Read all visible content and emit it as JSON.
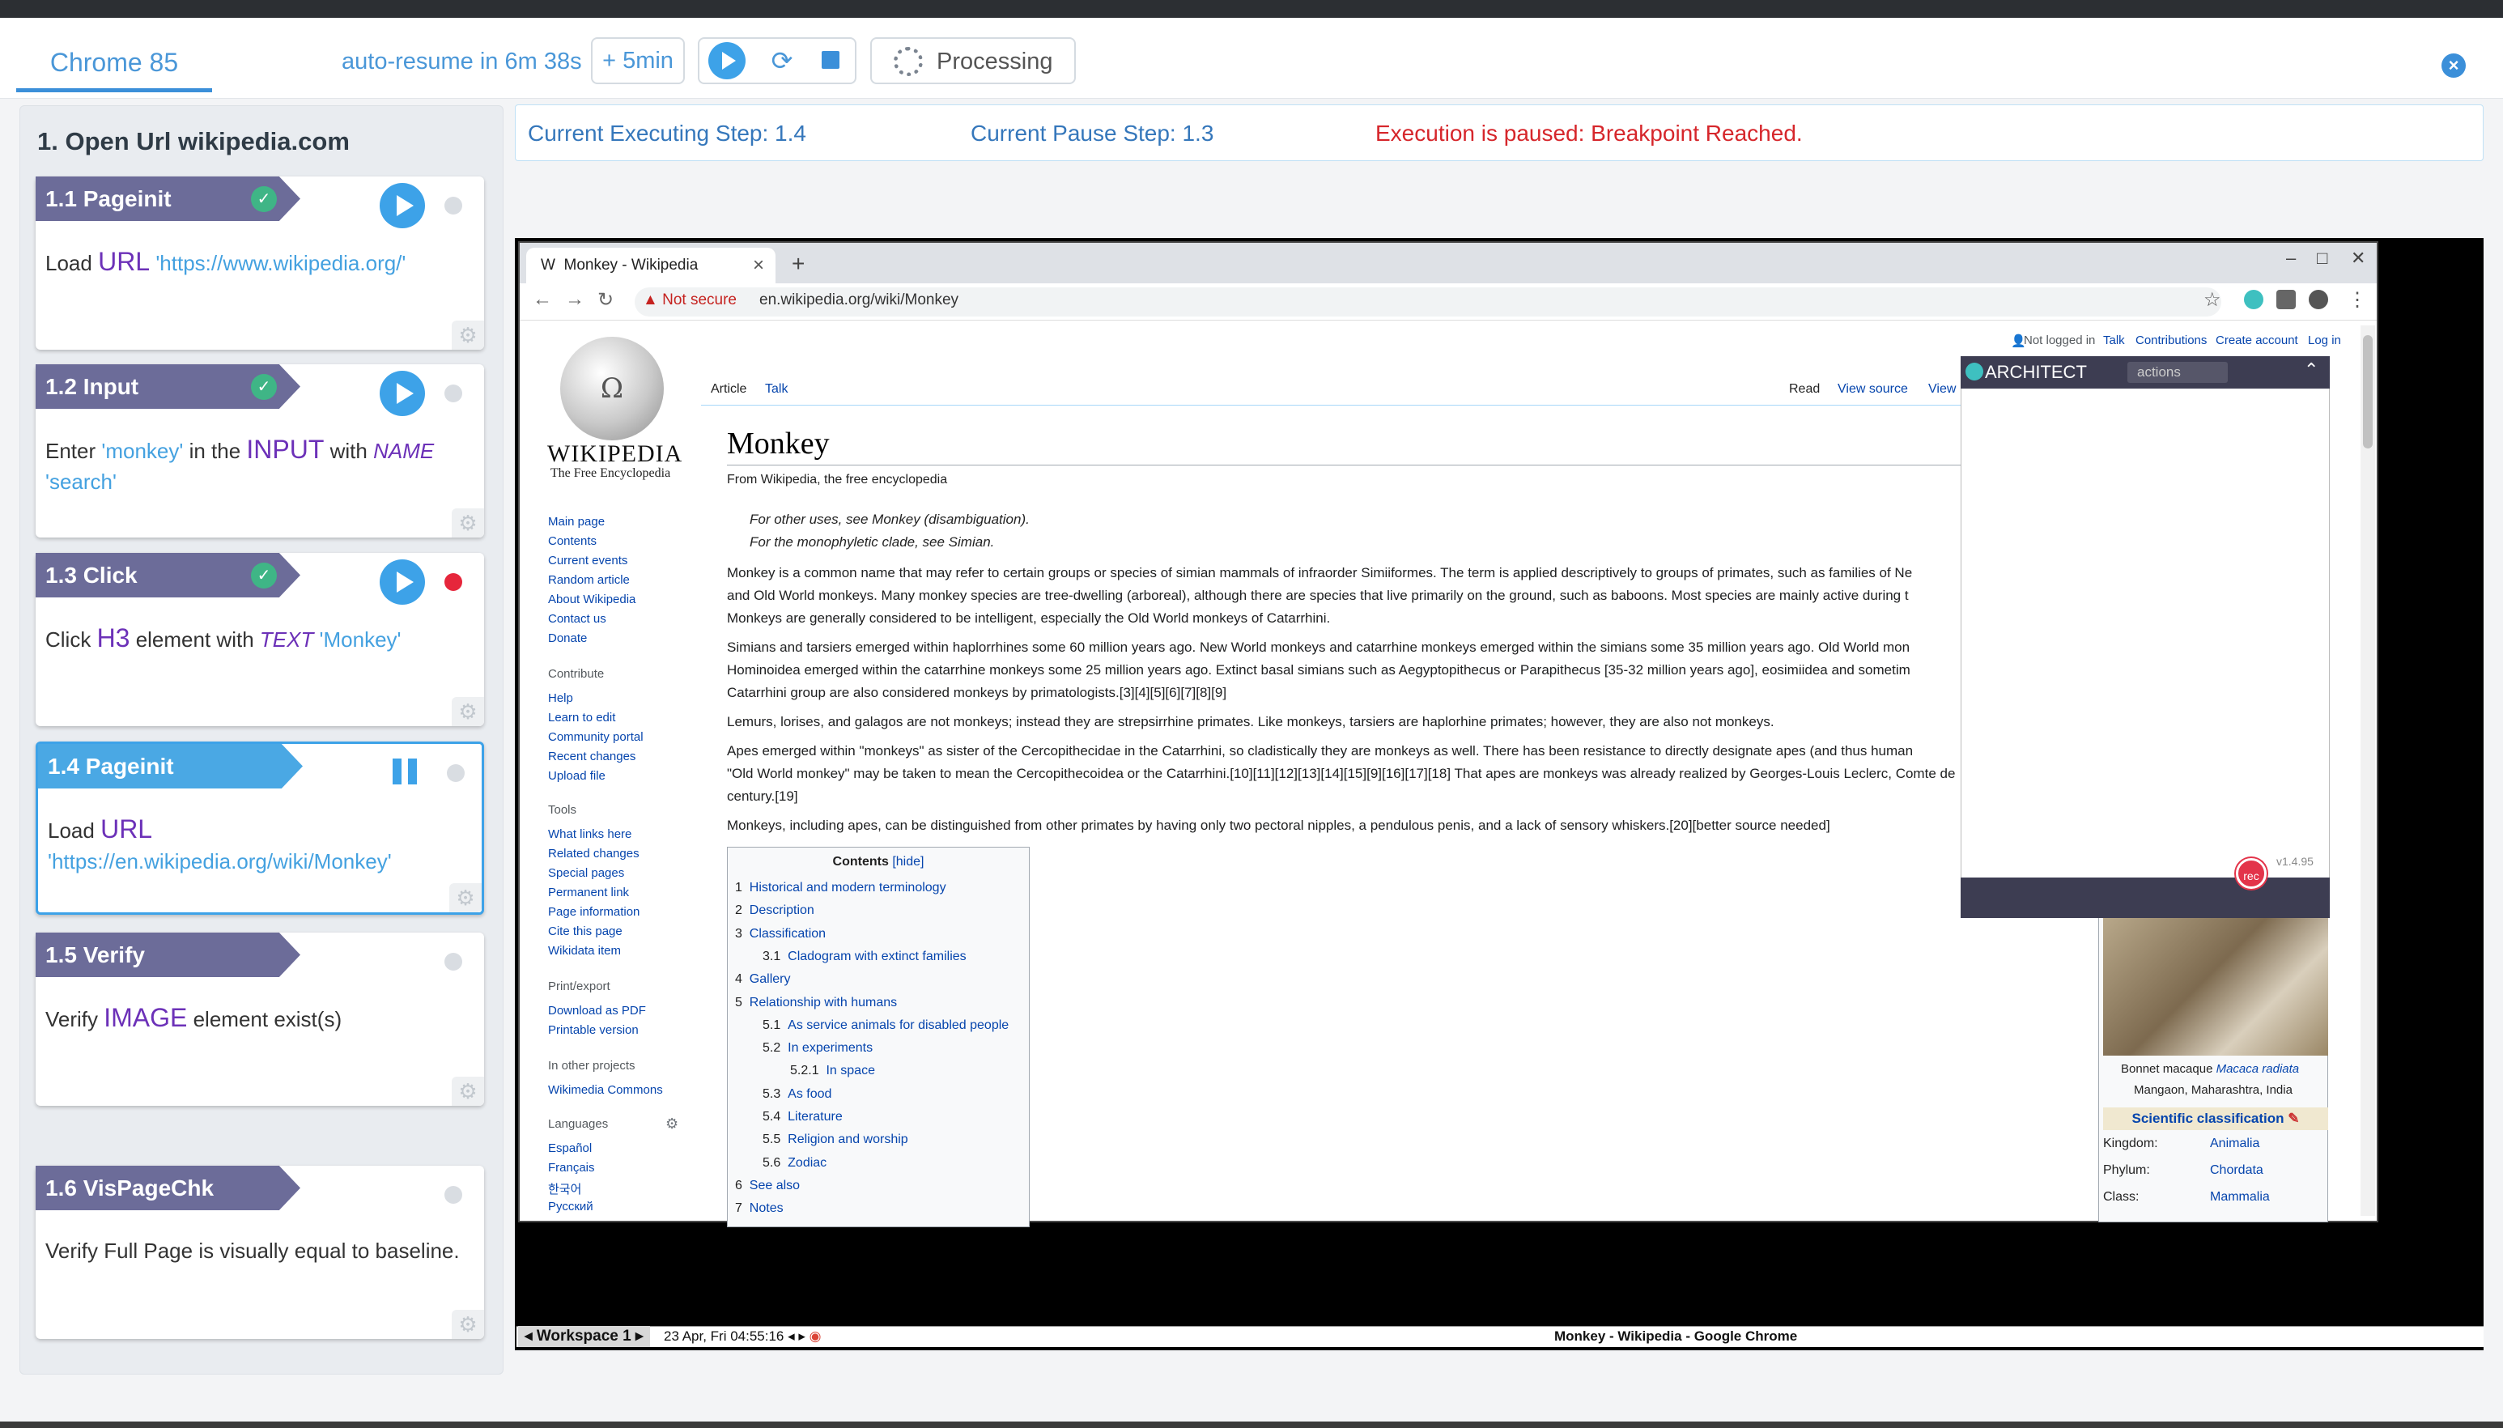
{
  "header": {
    "tab_title": "Chrome 85",
    "auto_resume": "auto-resume in 6m 38s",
    "add_time": "5min",
    "processing": "Processing"
  },
  "steps": {
    "heading": "1. Open Url wikipedia.com",
    "cards": [
      {
        "title": "1.1 Pageinit",
        "status": "passed",
        "parts": [
          "Load ",
          "URL",
          " 'https://www.wikipedia.org/'"
        ]
      },
      {
        "title": "1.2 Input",
        "status": "passed",
        "parts": [
          "Enter ",
          "'monkey'",
          " in the ",
          "INPUT",
          " with ",
          "NAME",
          " 'search'"
        ]
      },
      {
        "title": "1.3 Click",
        "status": "passed",
        "parts": [
          "Click ",
          "H3",
          " element with ",
          "TEXT",
          " 'Monkey'"
        ]
      },
      {
        "title": "1.4 Pageinit",
        "status": "paused",
        "parts": [
          "Load ",
          "URL",
          " 'https://en.wikipedia.org/wiki/Monkey'"
        ]
      },
      {
        "title": "1.5 Verify",
        "status": "pending",
        "parts": [
          "Verify ",
          "IMAGE",
          " element exist(s)"
        ]
      },
      {
        "title": "1.6 VisPageChk",
        "status": "pending",
        "parts": [
          "Verify Full Page is visually equal to baseline."
        ]
      }
    ]
  },
  "status": {
    "executing": "Current Executing Step: 1.4",
    "pause": "Current Pause Step: 1.3",
    "message": "Execution is paused: Breakpoint Reached.",
    "message_color": "#d6262b"
  },
  "browser": {
    "tab_title": "Monkey - Wikipedia",
    "not_secure": "Not secure",
    "url": "en.wikipedia.org/wiki/Monkey",
    "window_title": "Monkey - Wikipedia - Google Chrome",
    "workspace": "Workspace 1",
    "datetime": "23 Apr, Fri 04:55:16"
  },
  "wikipedia": {
    "logo_name": "WIKIPEDIA",
    "logo_tagline": "The Free Encyclopedia",
    "tabs": {
      "article": "Article",
      "talk": "Talk",
      "read": "Read",
      "view_source": "View source",
      "view": "View"
    },
    "user_links": [
      "Not logged in",
      "Talk",
      "Contributions",
      "Create account",
      "Log in"
    ],
    "sidebar": {
      "main": [
        "Main page",
        "Contents",
        "Current events",
        "Random article",
        "About Wikipedia",
        "Contact us",
        "Donate"
      ],
      "contribute_heading": "Contribute",
      "contribute": [
        "Help",
        "Learn to edit",
        "Community portal",
        "Recent changes",
        "Upload file"
      ],
      "tools_heading": "Tools",
      "tools": [
        "What links here",
        "Related changes",
        "Special pages",
        "Permanent link",
        "Page information",
        "Cite this page",
        "Wikidata item"
      ],
      "print_heading": "Print/export",
      "print": [
        "Download as PDF",
        "Printable version"
      ],
      "other_heading": "In other projects",
      "other": [
        "Wikimedia Commons"
      ],
      "lang_heading": "Languages",
      "languages": [
        "Español",
        "Français",
        "한국어",
        "Русский"
      ]
    },
    "title": "Monkey",
    "from": "From Wikipedia, the free encyclopedia",
    "hatnotes": [
      "For other uses, see Monkey (disambiguation).",
      "For the monophyletic clade, see Simian."
    ],
    "paragraphs": [
      "Monkey is a common name that may refer to certain groups or species of simian mammals of infraorder Simiiformes. The term is applied descriptively to groups of primates, such as families of Ne",
      "and Old World monkeys. Many monkey species are tree-dwelling (arboreal), although there are species that live primarily on the ground, such as baboons. Most species are mainly active during t",
      "Monkeys are generally considered to be intelligent, especially the Old World monkeys of Catarrhini.",
      "Simians and tarsiers emerged within haplorrhines some 60 million years ago. New World monkeys and catarrhine monkeys emerged within the simians some 35 million years ago. Old World mon",
      "Hominoidea emerged within the catarrhine monkeys some 25 million years ago. Extinct basal simians such as Aegyptopithecus or Parapithecus [35-32 million years ago], eosimiidea and sometim",
      "Catarrhini group are also considered monkeys by primatologists.[3][4][5][6][7][8][9]",
      "Lemurs, lorises, and galagos are not monkeys; instead they are strepsirrhine primates. Like monkeys, tarsiers are haplorhine primates; however, they are also not monkeys.",
      "Apes emerged within \"monkeys\" as sister of the Cercopithecidae in the Catarrhini, so cladistically they are monkeys as well. There has been resistance to directly designate apes (and thus human",
      "\"Old World monkey\" may be taken to mean the Cercopithecoidea or the Catarrhini.[10][11][12][13][14][15][9][16][17][18] That apes are monkeys was already realized by Georges-Louis Leclerc, Comte de",
      "century.[19]",
      "Monkeys, including apes, can be distinguished from other primates by having only two pectoral nipples, a pendulous penis, and a lack of sensory whiskers.[20][better source needed]"
    ],
    "toc_title": "Contents",
    "toc_hide": "[hide]",
    "toc": [
      {
        "n": "1",
        "t": "Historical and modern terminology",
        "lvl": 0
      },
      {
        "n": "2",
        "t": "Description",
        "lvl": 0
      },
      {
        "n": "3",
        "t": "Classification",
        "lvl": 0
      },
      {
        "n": "3.1",
        "t": "Cladogram with extinct families",
        "lvl": 1
      },
      {
        "n": "4",
        "t": "Gallery",
        "lvl": 0
      },
      {
        "n": "5",
        "t": "Relationship with humans",
        "lvl": 0
      },
      {
        "n": "5.1",
        "t": "As service animals for disabled people",
        "lvl": 1
      },
      {
        "n": "5.2",
        "t": "In experiments",
        "lvl": 1
      },
      {
        "n": "5.2.1",
        "t": "In space",
        "lvl": 2
      },
      {
        "n": "5.3",
        "t": "As food",
        "lvl": 1
      },
      {
        "n": "5.4",
        "t": "Literature",
        "lvl": 1
      },
      {
        "n": "5.5",
        "t": "Religion and worship",
        "lvl": 1
      },
      {
        "n": "5.6",
        "t": "Zodiac",
        "lvl": 1
      },
      {
        "n": "6",
        "t": "See also",
        "lvl": 0
      },
      {
        "n": "7",
        "t": "Notes",
        "lvl": 0
      }
    ],
    "infobox": {
      "caption_name": "Bonnet macaque",
      "caption_latin": "Macaca radiata",
      "caption_place": "Mangaon, Maharashtra, India",
      "sci_class": "Scientific classification",
      "rows": [
        {
          "k": "Kingdom:",
          "v": "Animalia"
        },
        {
          "k": "Phylum:",
          "v": "Chordata"
        },
        {
          "k": "Class:",
          "v": "Mammalia"
        }
      ]
    }
  },
  "architect": {
    "title": "ARCHITECT",
    "actions": "actions",
    "version": "v1.4.95",
    "rec": "rec"
  }
}
